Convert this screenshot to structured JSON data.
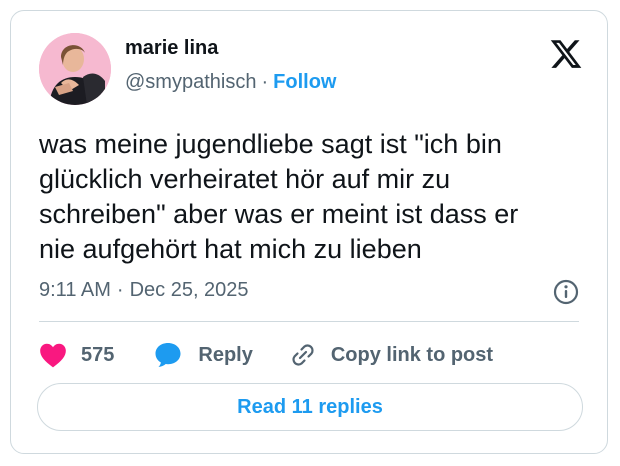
{
  "author": {
    "display_name": "marie lina",
    "handle": "@smypathisch",
    "separator": "·",
    "follow_label": "Follow"
  },
  "tweet": {
    "text": "was meine jugendliebe sagt ist \"ich bin\nglücklich verheiratet hör auf mir zu\nschreiben\" aber was er meint ist dass er\nnie aufgehört hat mich zu lieben",
    "time": "9:11 AM",
    "separator": "·",
    "date": "Dec 25, 2025"
  },
  "actions": {
    "like_count": "575",
    "reply_label": "Reply",
    "copy_link_label": "Copy link to post"
  },
  "read_replies_label": "Read 11 replies",
  "icons": {
    "brand": "x-logo-icon",
    "info": "info-icon",
    "like": "heart-icon",
    "reply": "speech-bubble-icon",
    "copy": "link-icon",
    "avatar": "profile-photo"
  },
  "colors": {
    "accent": "#1d9bf0",
    "heart": "#f91880",
    "text": "#0f1419",
    "secondary": "#536471",
    "border": "#cfd9de"
  }
}
